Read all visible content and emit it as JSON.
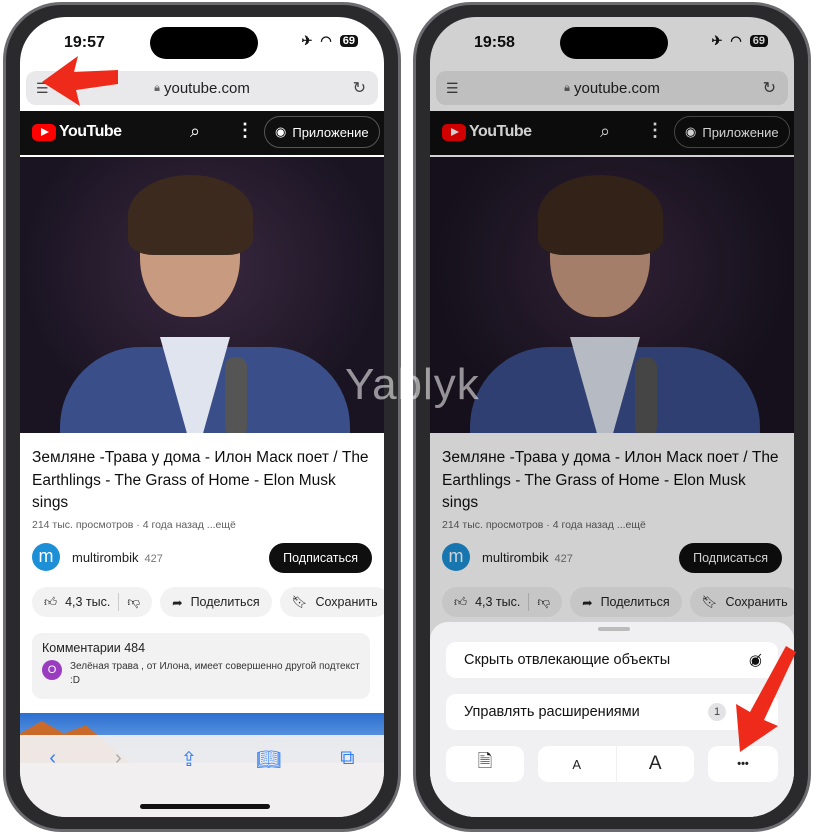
{
  "phones": {
    "left": {
      "time": "19:57",
      "battery": "69"
    },
    "right": {
      "time": "19:58",
      "battery": "69"
    }
  },
  "browser": {
    "url": "youtube.com"
  },
  "youtube": {
    "logo": "YouTube",
    "app_button": "Приложение",
    "title": "Земляне -Трава у дома - Илон Маск поет / The Earthlings - The Grass of Home - Elon Musk sings",
    "meta": "214 тыс. просмотров · 4 года назад   ...ещё",
    "channel": {
      "avatar_letter": "m",
      "name": "multirombik",
      "count": "427",
      "subscribe": "Подписаться"
    },
    "actions": {
      "likes": "4,3 тыс.",
      "share": "Поделиться",
      "save": "Сохранить"
    },
    "comments": {
      "header": "Комментарии 484",
      "avatar_letter": "O",
      "text": "Зелёная трава , от Илона, имеет совершенно другой подтекст :D"
    }
  },
  "sheet": {
    "hide_distracting": "Скрыть отвлекающие объекты",
    "manage_extensions": "Управлять расширениями",
    "extensions_count": "1",
    "font_small": "A",
    "font_large": "A",
    "more": "•••"
  },
  "watermark": "Yablyk",
  "colors": {
    "accent": "#2f7df6",
    "annotation_arrow": "#ee2a1b",
    "youtube_red": "#ff0000"
  }
}
